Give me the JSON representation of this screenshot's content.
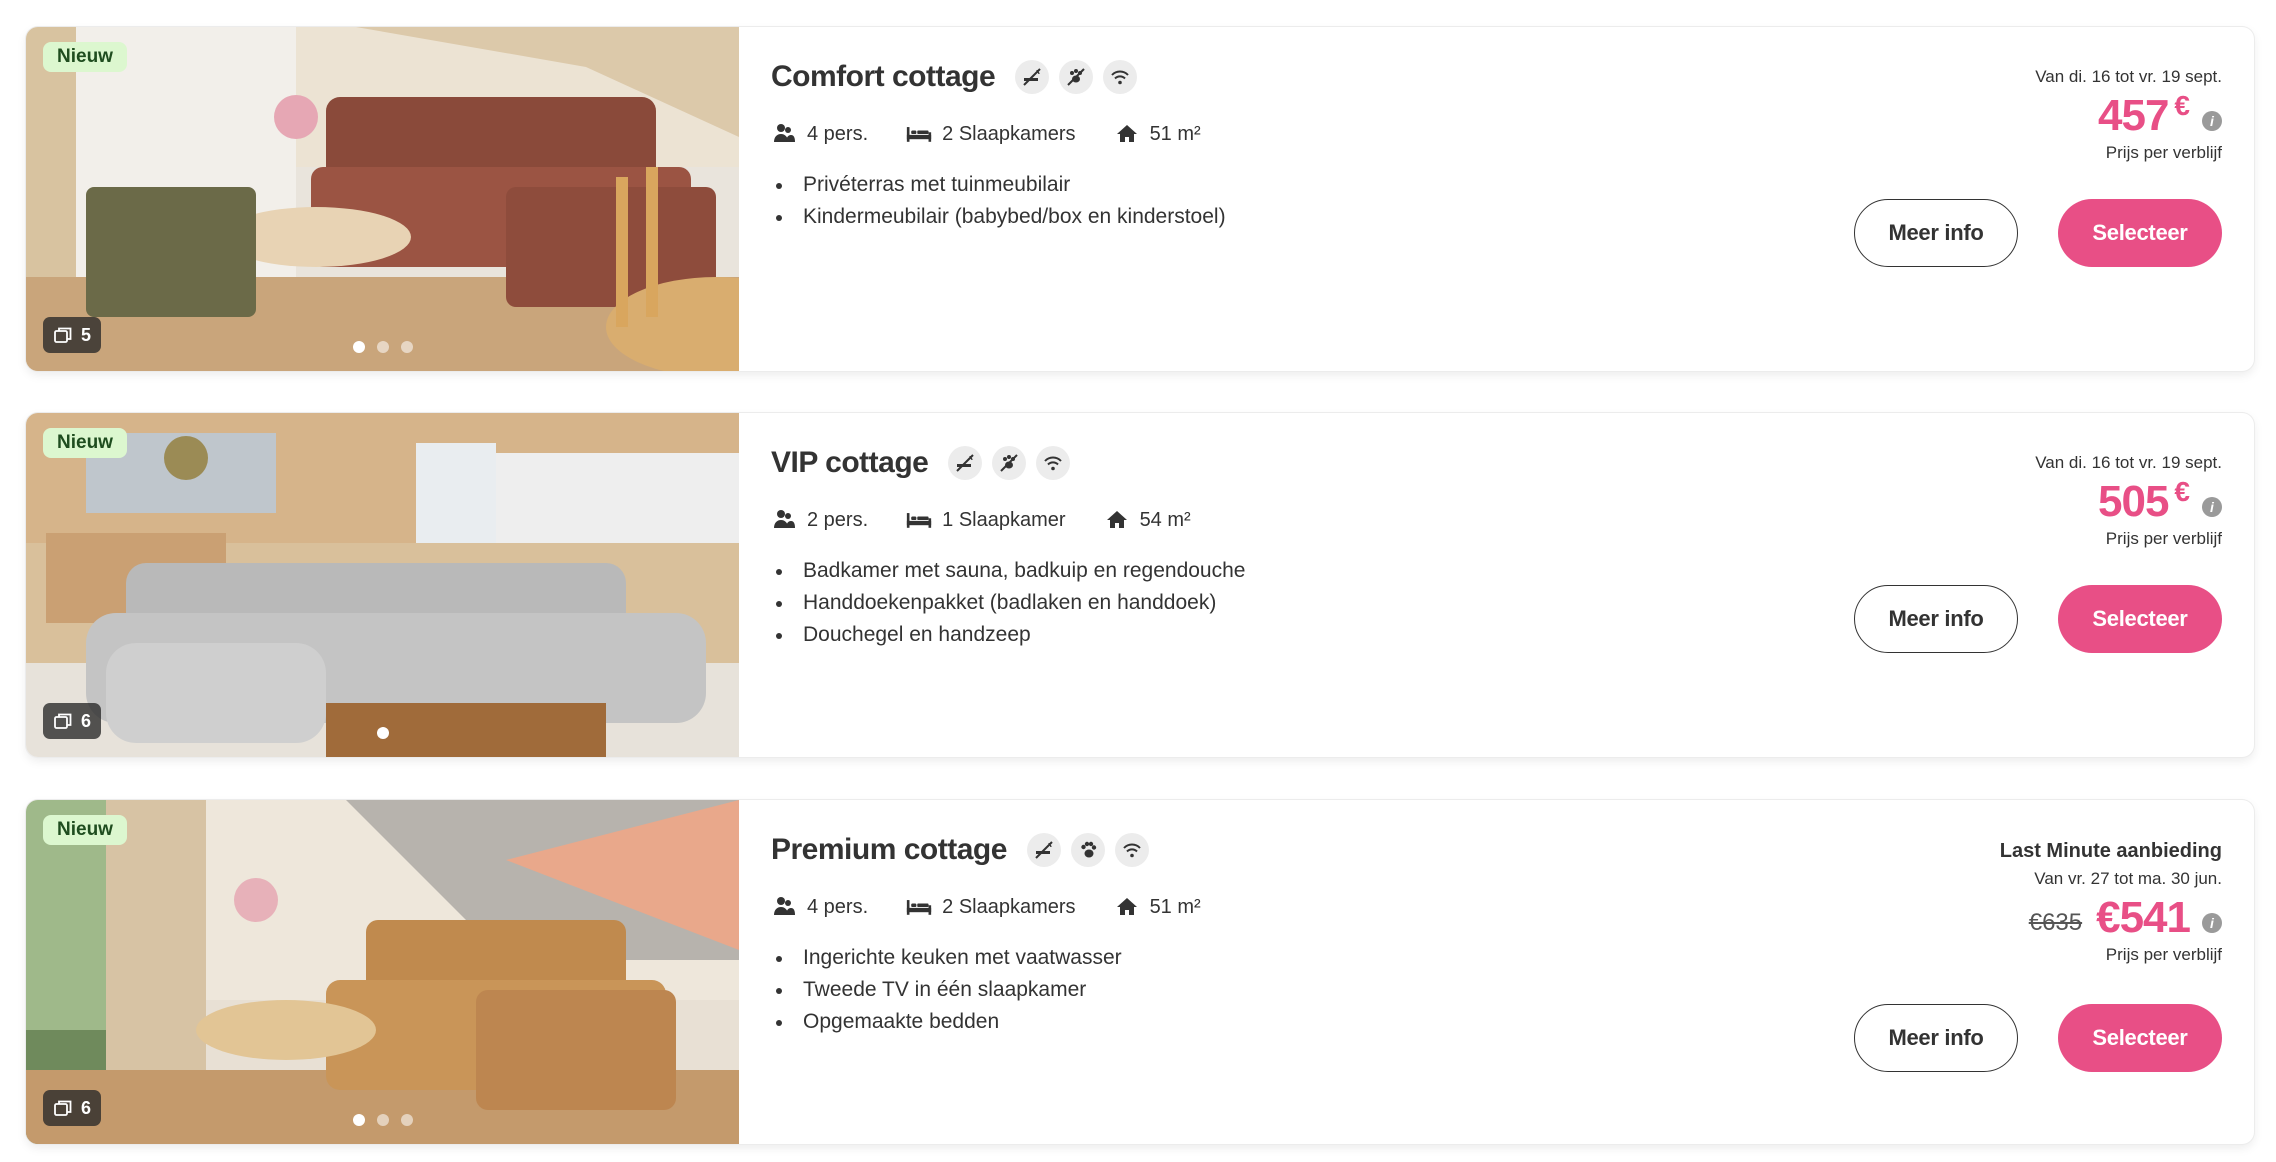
{
  "colors": {
    "accent": "#e84f86",
    "badge_bg": "#dcf7cf"
  },
  "cards": [
    {
      "badge": "Nieuw",
      "photo_count": "5",
      "title": "Comfort cottage",
      "amenities": [
        "no-smoking-icon",
        "no-pets-icon",
        "wifi-icon"
      ],
      "persons": "4 pers.",
      "bedrooms": "2 Slaapkamers",
      "area": "51 m²",
      "bullets": [
        "Privéterras met tuinmeubilair",
        "Kindermeubilair (babybed/box en kinderstoel)"
      ],
      "last_minute": "",
      "dates": "Van di. 16 tot vr. 19 sept.",
      "old_price": "",
      "price": "457",
      "currency": "€",
      "price_note": "Prijs per verblijf",
      "more_label": "Meer info",
      "select_label": "Selecteer"
    },
    {
      "badge": "Nieuw",
      "photo_count": "6",
      "title": "VIP cottage",
      "amenities": [
        "no-smoking-icon",
        "no-pets-icon",
        "wifi-icon"
      ],
      "persons": "2 pers.",
      "bedrooms": "1 Slaapkamer",
      "area": "54 m²",
      "bullets": [
        "Badkamer met sauna, badkuip en regendouche",
        "Handdoekenpakket (badlaken en handdoek)",
        "Douchegel en handzeep"
      ],
      "last_minute": "",
      "dates": "Van di. 16 tot vr. 19 sept.",
      "old_price": "",
      "price": "505",
      "currency": "€",
      "price_note": "Prijs per verblijf",
      "more_label": "Meer info",
      "select_label": "Selecteer"
    },
    {
      "badge": "Nieuw",
      "photo_count": "6",
      "title": "Premium cottage",
      "amenities": [
        "no-smoking-icon",
        "pets-allowed-icon",
        "wifi-icon"
      ],
      "persons": "4 pers.",
      "bedrooms": "2 Slaapkamers",
      "area": "51 m²",
      "bullets": [
        "Ingerichte keuken met vaatwasser",
        "Tweede TV in één slaapkamer",
        "Opgemaakte bedden"
      ],
      "last_minute": "Last Minute aanbieding",
      "dates": "Van vr. 27 tot ma. 30 jun.",
      "old_price": "€635",
      "price": "€541",
      "currency": "",
      "price_note": "Prijs per verblijf",
      "more_label": "Meer info",
      "select_label": "Selecteer"
    }
  ]
}
